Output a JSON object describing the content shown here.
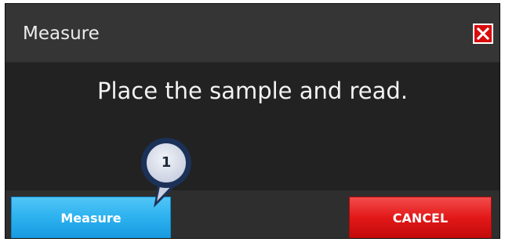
{
  "dialog": {
    "title": "Measure",
    "message": "Place the sample and read.",
    "close_icon": "close-icon",
    "close_color": "#d90c0c"
  },
  "buttons": {
    "measure_label": "Measure",
    "measure_color": "#2fb3f0",
    "cancel_label": "CANCEL",
    "cancel_color": "#e21818"
  },
  "callout": {
    "number": "1",
    "fill_color": "#dde2ee",
    "ring_color": "#1c3157"
  }
}
